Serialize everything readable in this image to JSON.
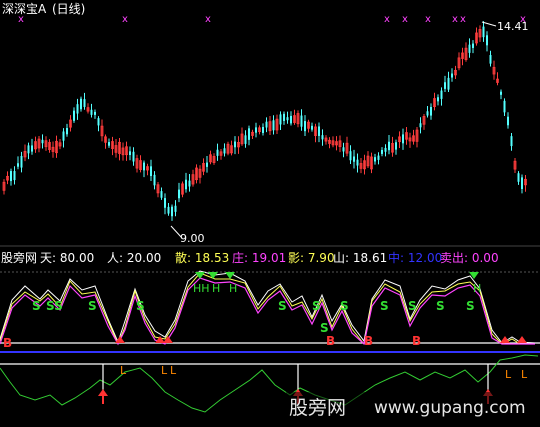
{
  "colors": {
    "up": "#ff3d3d",
    "down": "#54ffff",
    "white": "#ffffff",
    "yellow": "#ffff55",
    "magenta": "#ff44ff",
    "green": "#33dd33",
    "blue": "#3333ff",
    "red_marker": "#ff3333",
    "grid": "#444444"
  },
  "header": {
    "title": "深深宝A",
    "period": "(日线)"
  },
  "price_panel": {
    "high_label": "14.41",
    "low_label": "9.00",
    "x_marker": "x"
  },
  "indicator_bar": [
    {
      "label": "股旁网",
      "color": "#ffffff"
    },
    {
      "label": "天: 80.00",
      "color": "#ffffff"
    },
    {
      "label": "人: 20.00",
      "color": "#ffffff"
    },
    {
      "label": "散: 18.53",
      "color": "#ffff55"
    },
    {
      "label": "庄: 19.01",
      "color": "#ff44ff"
    },
    {
      "label": "影: 7.90",
      "color": "#ffff55"
    },
    {
      "label": "山: 18.61",
      "color": "#ffffff"
    },
    {
      "label": "中: 12.00",
      "color": "#3333ff"
    },
    {
      "label": "卖出: 0.00",
      "color": "#ff44ff"
    }
  ],
  "signals": {
    "S": "S",
    "SS": "SS",
    "B": "B",
    "H": "H",
    "HH": "HH",
    "L": "L"
  },
  "watermark": {
    "cn": "股旁网",
    "url": "www.gupang.com"
  }
}
